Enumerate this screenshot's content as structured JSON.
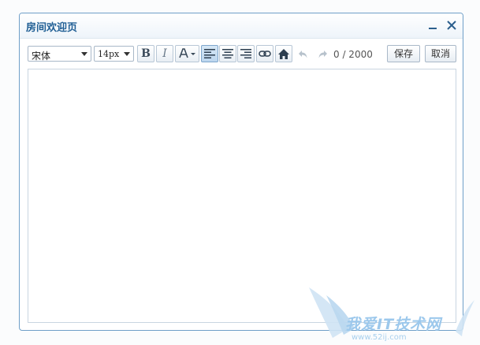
{
  "dialog": {
    "title": "房间欢迎页"
  },
  "toolbar": {
    "font_family": "宋体",
    "font_size": "14px",
    "counter": "0 / 2000",
    "save_label": "保存",
    "cancel_label": "取消"
  },
  "editor": {
    "content": ""
  },
  "watermark": {
    "text": "我爱IT技术网",
    "url": "www.52ij.com"
  },
  "colors": {
    "accent": "#1f5e94",
    "border": "#6f9fc8",
    "active_button": "#bcd6ee"
  }
}
